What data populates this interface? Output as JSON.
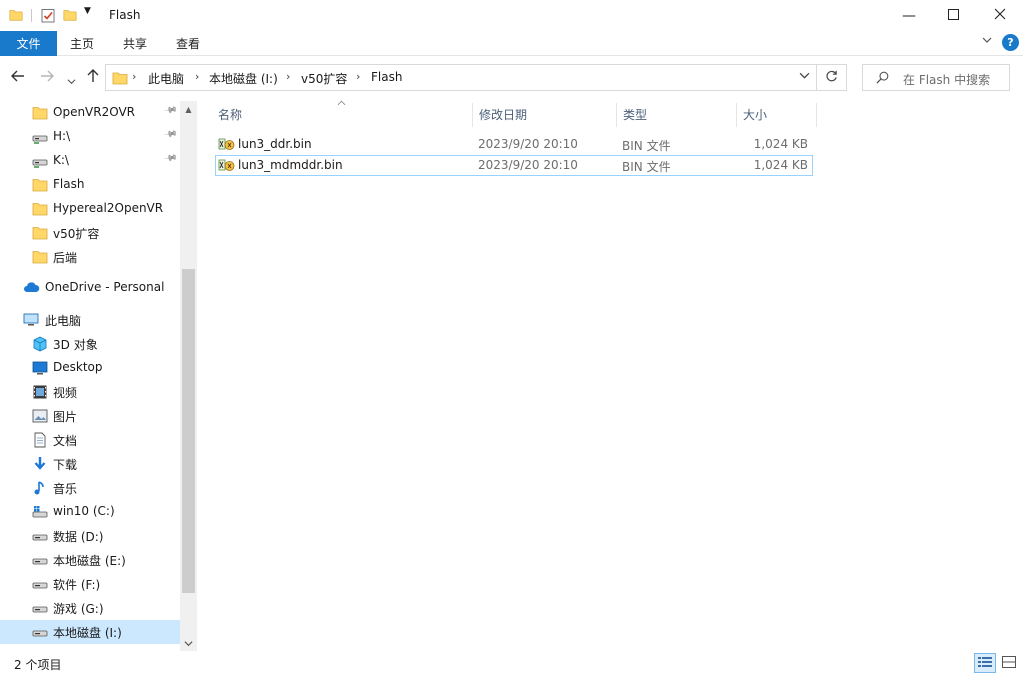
{
  "window": {
    "title": "Flash"
  },
  "ribbon": {
    "tabs": {
      "file": "文件",
      "home": "主页",
      "share": "共享",
      "view": "查看"
    },
    "help": "?"
  },
  "addressbar": {
    "crumbs": [
      "此电脑",
      "本地磁盘 (I:)",
      "v50扩容",
      "Flash"
    ]
  },
  "search": {
    "placeholder": "在 Flash 中搜索"
  },
  "nav": {
    "quick_access": [
      "OpenVR2OVR",
      "H:\\",
      "K:\\",
      "Flash",
      "Hypereal2OpenVR",
      "v50扩容",
      "后端"
    ],
    "onedrive": "OneDrive - Personal",
    "this_pc": "此电脑",
    "pc_items": [
      "3D 对象",
      "Desktop",
      "视频",
      "图片",
      "文档",
      "下载",
      "音乐",
      "win10 (C:)",
      "数据 (D:)",
      "本地磁盘 (E:)",
      "软件 (F:)",
      "游戏 (G:)",
      "本地磁盘 (I:)"
    ]
  },
  "columns": {
    "name": "名称",
    "modified": "修改日期",
    "type": "类型",
    "size": "大小"
  },
  "files": [
    {
      "name": "lun3_ddr.bin",
      "modified": "2023/9/20 20:10",
      "type": "BIN 文件",
      "size": "1,024 KB"
    },
    {
      "name": "lun3_mdmddr.bin",
      "modified": "2023/9/20 20:10",
      "type": "BIN 文件",
      "size": "1,024 KB"
    }
  ],
  "status": {
    "item_count": "2 个项目"
  },
  "colors": {
    "accent": "#1979ca",
    "selection": "#cce8ff",
    "folder": "#ffd767"
  }
}
